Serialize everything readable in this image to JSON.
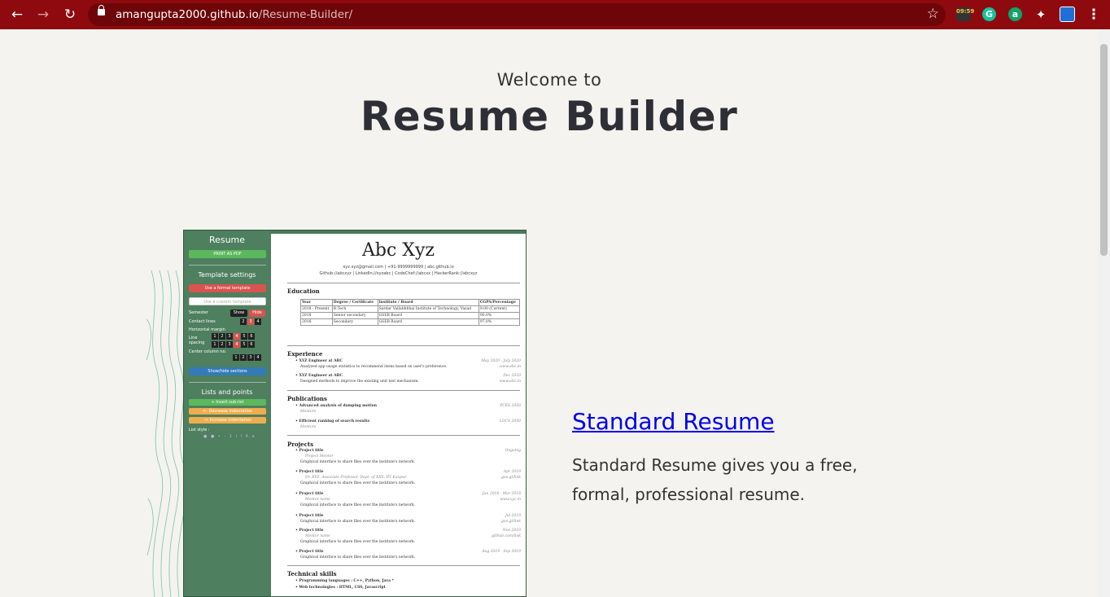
{
  "browser": {
    "url_host": "amangupta2000.github.io",
    "url_path": "/Resume-Builder/",
    "ext_badge": "09:59",
    "ext_a": "a",
    "ext_g": "G"
  },
  "hero": {
    "welcome": "Welcome to",
    "title": "Resume Builder"
  },
  "card": {
    "title": "Standard Resume",
    "desc": "Standard Resume gives you a free, formal, professional resume."
  },
  "preview": {
    "sidebar": {
      "title": "Resume",
      "print": "PRINT AS PDF",
      "settings": "Template settings",
      "formal": "Use a formal template",
      "custom": "Use a custom template",
      "semester": "Semester",
      "show": "Show",
      "hide": "Hide",
      "contact": "Contact lines",
      "hmargin": "Horizontal margin",
      "lspacing": "Line spacing",
      "center": "Center column no.",
      "showhide": "Show/hide sections",
      "lists": "Lists and points",
      "insert": "+ Insert sub-list",
      "decrease": "<- Decrease indentation",
      "increase": "-> Increase indentation",
      "liststyle": "List style :",
      "nums": [
        "1",
        "2",
        "3",
        "4",
        "5",
        "6"
      ]
    },
    "doc": {
      "name": "Abc Xyz",
      "contact1": "xyz.xyz@gmail.com | +91-9999999999 | abc.github.io",
      "contact2": "Github://abcxyz | LinkedIn://xyzabc | CodeChef://abcxx | HackerRank://abcxyz",
      "s_edu": "Education",
      "s_exp": "Experience",
      "s_pub": "Publications",
      "s_proj": "Projects",
      "s_tech": "Technical skills",
      "edu_rows": [
        [
          "Year",
          "Degree / Certificate",
          "Institute / Board",
          "CGPA/Percentage"
        ],
        [
          "2018 - Present",
          "B.Tech",
          "Sardar Vallabhbhai Institute of Technology, Vasad",
          "9.00 (Current)"
        ],
        [
          "2018",
          "Senior secondary",
          "GSEB Board",
          "90.0%"
        ],
        [
          "2016",
          "Secondary",
          "GSEB Board",
          "97.0%"
        ]
      ],
      "exp1": "XYZ Engineer at ABC",
      "exp1d": "May 2020 - July 2020",
      "exp1t": "Analyzed app usage statistics to recommend items based on user's preference.",
      "exp1u": "www.abc.in",
      "exp2": "XYZ Engineer at ABC",
      "exp2d": "Dec 2020",
      "exp2t": "Designed methods to improve the existing unit test mechanism.",
      "exp2u": "www.abc.in",
      "pub1": "Advanced analysis of damping motion",
      "pub1d": "PCES 2050",
      "pub2": "Efficient ranking of search results",
      "pub2d": "LOCS 2050",
      "mentors": "Mentors",
      "proj": "Project title",
      "projt": "Graphical interface to share files over the institute's network.",
      "pm": "Project Mentor",
      "mn": "Mentor name",
      "pd1": "Ongoing",
      "pd2": "Apr 2019",
      "pd3": "Jun 2018 - Mar 2018",
      "pd4": "Jul 2019",
      "pd5": "Nov 2019",
      "pd6": "Aug 2019 - Sep 2019",
      "pl2": "goo.gl/link",
      "pl3": "www.xyz.in",
      "pl4": "goo.gl/link",
      "pl5": "github.com/link",
      "prof": "Dr. XYZ, Associate Professor, Dept. of XXX, IIT Kanpur",
      "tech1": "Programming languages : C++, Python, Java *",
      "tech2": "Web technologies : HTML, CSS, Javascript"
    }
  }
}
